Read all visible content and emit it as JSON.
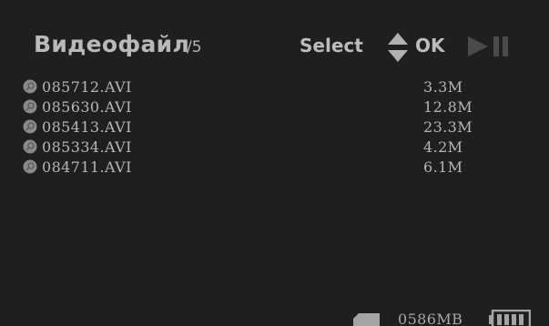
{
  "header": {
    "title": "Видеофайл",
    "count": "/5",
    "hints": {
      "select_label": "Select",
      "select_icon": "up-down-arrows-icon",
      "ok_label": "OK",
      "playpause_icon": "play-pause-icon"
    }
  },
  "files": [
    {
      "name": "085712.AVI",
      "size": "3.3M"
    },
    {
      "name": "085630.AVI",
      "size": "12.8M"
    },
    {
      "name": "085413.AVI",
      "size": "23.3M"
    },
    {
      "name": "085334.AVI",
      "size": "4.2M"
    },
    {
      "name": "084711.AVI",
      "size": "6.1M"
    }
  ],
  "status": {
    "storage_icon": "sd-card-icon",
    "storage_free": "0586MB",
    "battery_icon": "battery-icon"
  },
  "colors": {
    "background": "#1f1f1f",
    "text": "#b6b6b6",
    "dim_icon": "#5a5a5a"
  }
}
